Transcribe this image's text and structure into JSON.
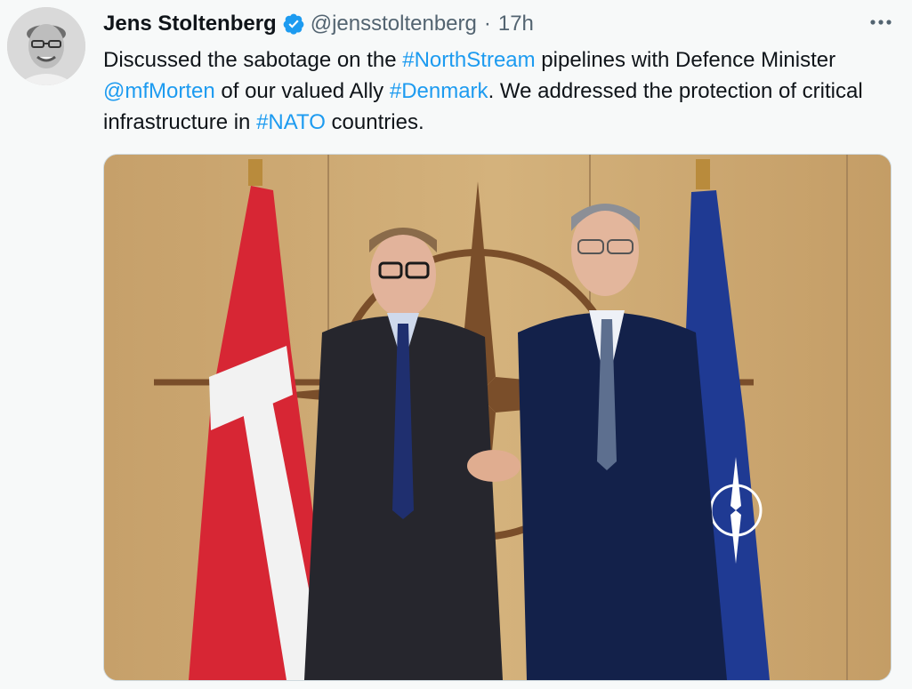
{
  "author": {
    "name": "Jens Stoltenberg",
    "handle": "@jensstoltenberg",
    "separator": "·",
    "time": "17h",
    "verified": true
  },
  "text": {
    "p1": "Discussed the sabotage on the ",
    "tag1": "#NorthStream",
    "p2": " pipelines with Defence Minister ",
    "mention": "@mfMorten",
    "p3": " of our valued Ally ",
    "tag2": "#Denmark",
    "p4": ". We addressed the protection of critical infrastructure in ",
    "tag3": "#NATO",
    "p5": " countries."
  },
  "icons": {
    "verified": "verified-badge-icon",
    "more": "more-options-icon"
  },
  "colors": {
    "link": "#1d9bf0",
    "verified": "#1d9bf0",
    "secondary_text": "#536471",
    "background": "#f7f9f9"
  }
}
